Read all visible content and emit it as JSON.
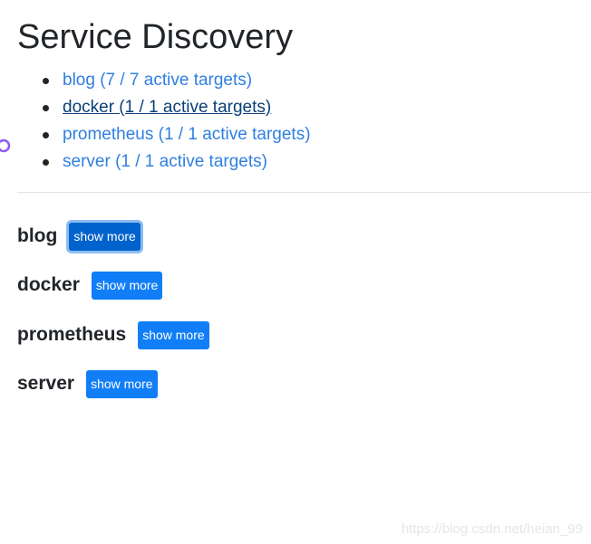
{
  "page": {
    "title": "Service Discovery"
  },
  "targets": [
    {
      "label": "blog (7 / 7 active targets)"
    },
    {
      "label": "docker (1 / 1 active targets)"
    },
    {
      "label": "prometheus (1 / 1 active targets)"
    },
    {
      "label": "server (1 / 1 active targets)"
    }
  ],
  "sections": [
    {
      "name": "blog",
      "button_label": "show more"
    },
    {
      "name": "docker",
      "button_label": "show more"
    },
    {
      "name": "prometheus",
      "button_label": "show more"
    },
    {
      "name": "server",
      "button_label": "show more"
    }
  ],
  "watermark": {
    "text": "https://blog.csdn.net/heian_99"
  },
  "colors": {
    "link": "#2f7fe0",
    "link_hover": "#0a3f78",
    "button": "#117ef7",
    "button_focus": "#0062cc"
  },
  "cursor": {
    "icon": "link-select-cursor-icon"
  }
}
